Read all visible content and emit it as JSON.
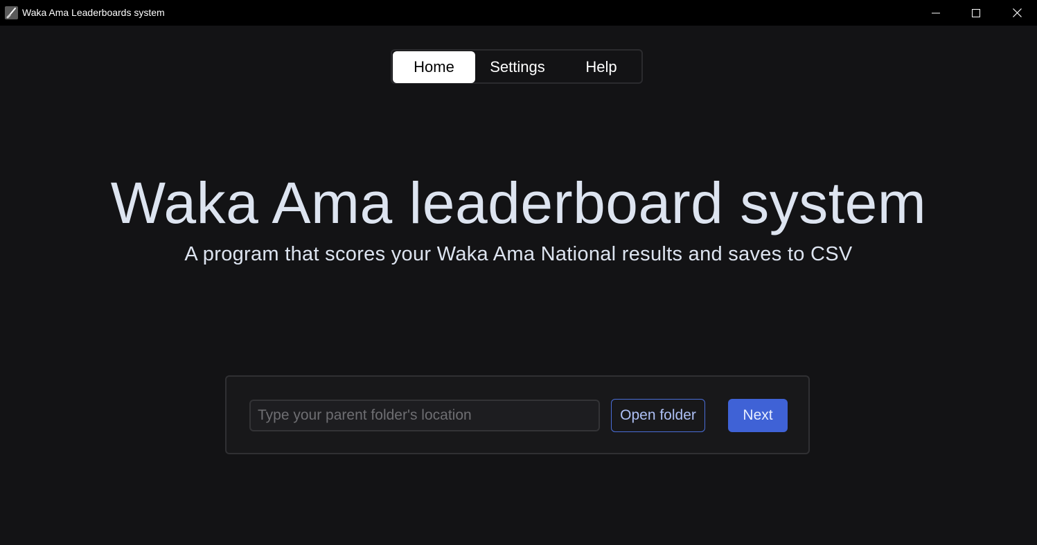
{
  "window": {
    "title": "Waka Ama Leaderboards system",
    "controls": [
      "minimize-icon",
      "maximize-icon",
      "close-icon"
    ]
  },
  "nav": {
    "tabs": [
      {
        "label": "Home",
        "active": true
      },
      {
        "label": "Settings",
        "active": false
      },
      {
        "label": "Help",
        "active": false
      }
    ]
  },
  "main": {
    "title": "Waka Ama leaderboard system",
    "subtitle": "A program that scores your Waka Ama National results and saves to CSV"
  },
  "folder_picker": {
    "input_value": "",
    "input_placeholder": "Type your parent folder's location",
    "open_folder_label": "Open folder",
    "next_label": "Next"
  },
  "colors": {
    "background": "#131315",
    "titlebar": "#000000",
    "accent": "#3f62d6",
    "text": "#dde4f0"
  }
}
